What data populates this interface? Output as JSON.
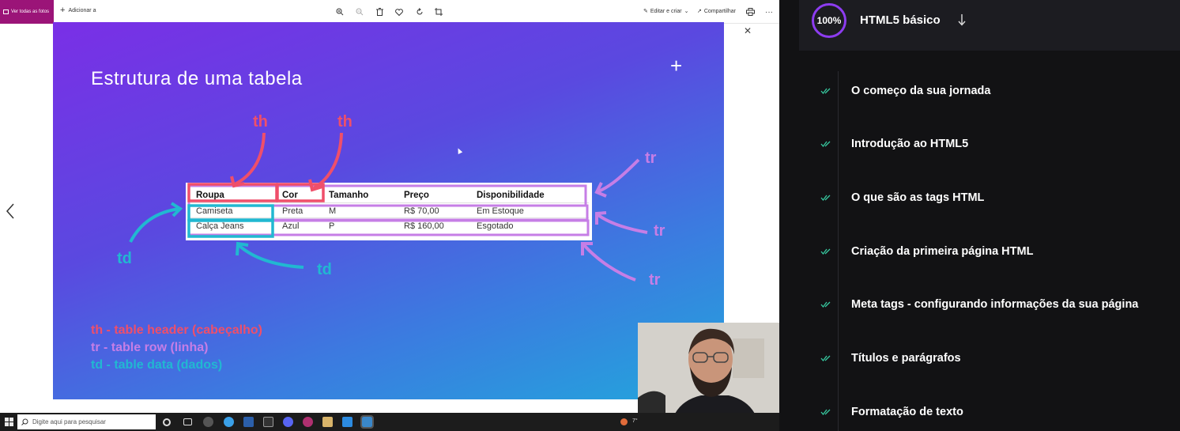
{
  "photos_viewer": {
    "see_all_label": "Ver todas as fotos",
    "add_label": "Adicionar a",
    "edit_create_label": "Editar e criar",
    "share_label": "Compartilhar"
  },
  "slide": {
    "title": "Estrutura de uma tabela",
    "table": {
      "headers": [
        "Roupa",
        "Cor",
        "Tamanho",
        "Preço",
        "Disponibilidade"
      ],
      "rows": [
        [
          "Camiseta",
          "Preta",
          "M",
          "R$ 70,00",
          "Em Estoque"
        ],
        [
          "Calça Jeans",
          "Azul",
          "P",
          "R$ 160,00",
          "Esgotado"
        ]
      ]
    },
    "labels": {
      "th": "th",
      "tr": "tr",
      "td": "td"
    },
    "legend": {
      "th": "th  - table header (cabeçalho)",
      "tr": "tr   - table row (linha)",
      "td": "td  - table data (dados)"
    },
    "colors": {
      "th": "#ef4f6a",
      "tr": "#c67ee6",
      "td": "#21b8d1"
    }
  },
  "taskbar": {
    "search_placeholder": "Digite aqui para pesquisar",
    "tray_text": "7°"
  },
  "course": {
    "progress": "100%",
    "module_title": "HTML5 básico",
    "accent": "#8d3cf0",
    "lessons": [
      "O começo da sua jornada",
      "Introdução ao HTML5",
      "O que são as tags HTML",
      "Criação da primeira página HTML",
      "Meta tags - configurando informações da sua página",
      "Títulos e parágrafos",
      "Formatação de texto"
    ]
  }
}
